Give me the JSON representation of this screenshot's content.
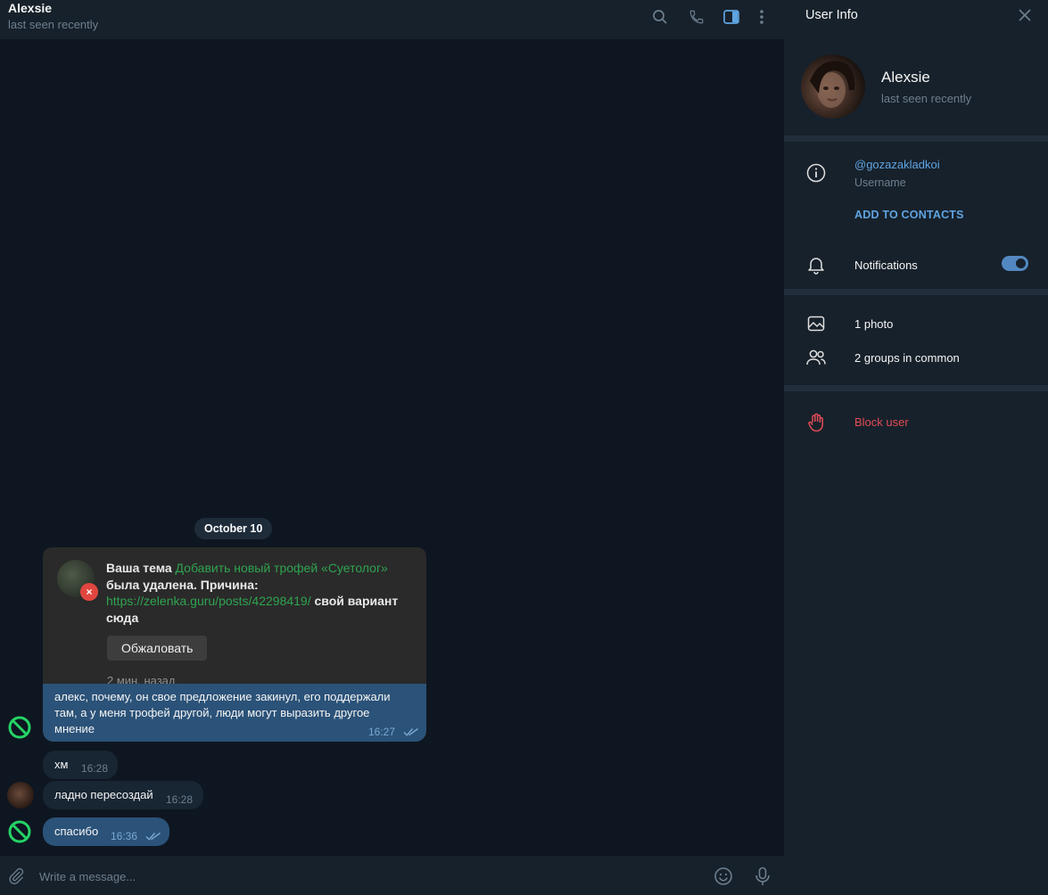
{
  "chat": {
    "title": "Alexsie",
    "status": "last seen recently",
    "icons": [
      "search-icon",
      "phone-icon",
      "sidebar-toggle-icon",
      "more-vertical-icon"
    ]
  },
  "date_divider": "October 10",
  "messages": {
    "forwarded": {
      "prefix": "Ваша тема ",
      "topic_link": "Добавить новый трофей «Суетолог»",
      "middle": " была удалена. Причина: ",
      "reason_link": "https://zelenka.guru/posts/42298419/",
      "suffix": " свой вариант сюда",
      "button": "Обжаловать",
      "ago": "2 мин. назад",
      "badge": "×"
    },
    "m1": {
      "text": "алекс, почему, он свое предложение закинул, его поддержали там, а у меня трофей другой, люди могут выразить другое мнение",
      "time": "16:27"
    },
    "m2": {
      "text": "хм",
      "time": "16:28"
    },
    "m3": {
      "text": "ладно пересоздай",
      "time": "16:28"
    },
    "m4": {
      "text": "спасибо",
      "time": "16:36"
    }
  },
  "composer": {
    "placeholder": "Write a message...",
    "icons": [
      "attach-icon",
      "emoji-icon",
      "microphone-icon"
    ]
  },
  "panel": {
    "title": "User Info",
    "name": "Alexsie",
    "status": "last seen recently",
    "username": "@gozazakladkoi",
    "username_label": "Username",
    "add_contacts": "ADD TO CONTACTS",
    "notifications": "Notifications",
    "notifications_on": true,
    "photos": "1 photo",
    "groups": "2 groups in common",
    "block": "Block user"
  },
  "colors": {
    "background": "#0e1621",
    "panel": "#17212b",
    "outgoing_bubble": "#2b5278",
    "incoming_bubble": "#182533",
    "accent": "#5fa4e2",
    "danger": "#e04c56",
    "link_green": "#2ea44f",
    "blocked_icon": "#25d366"
  }
}
